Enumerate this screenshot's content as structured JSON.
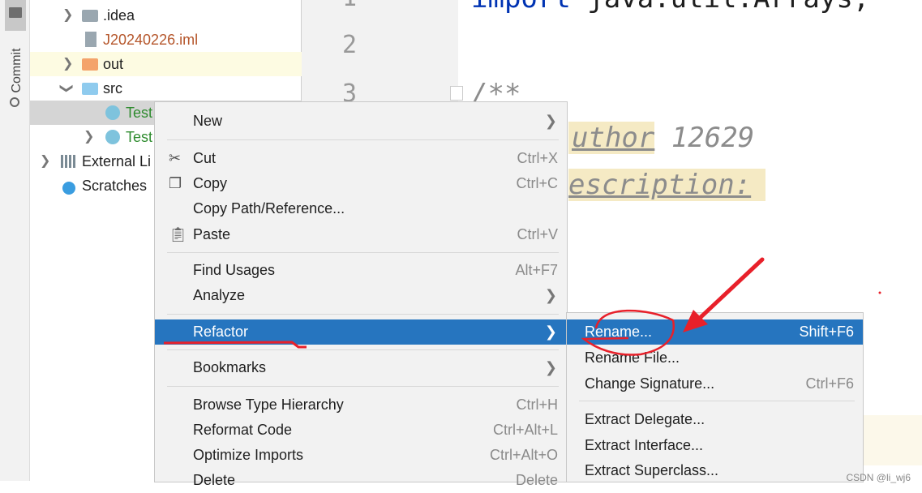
{
  "tool_strip": {
    "commit_label": "Commit"
  },
  "project_tree": [
    {
      "label": ".idea",
      "type": "folder",
      "color": "#1f1f1f"
    },
    {
      "label": "J20240226.iml",
      "type": "file",
      "color": "#b5562b"
    },
    {
      "label": "out",
      "type": "folder-orange",
      "color": "#1f1f1f"
    },
    {
      "label": "src",
      "type": "folder-blue",
      "color": "#1f1f1f"
    },
    {
      "label": "Test",
      "type": "class-run",
      "color": "#2e8b2e"
    },
    {
      "label": "Test",
      "type": "class",
      "color": "#2e8b2e"
    },
    {
      "label": "External Li",
      "type": "library",
      "color": "#1f1f1f"
    },
    {
      "label": "Scratches",
      "type": "scratches",
      "color": "#1f1f1f"
    }
  ],
  "editor": {
    "line_numbers": [
      "1",
      "2",
      "3"
    ],
    "line1_keyword": "import",
    "line1_rest": " java.util.Arrays;",
    "line3": "/**",
    "line4_tag": "uthor",
    "line4_rest": " 12629",
    "line5_tag": "escription:"
  },
  "context_menu": {
    "items": [
      {
        "label": "New",
        "arrow": true
      },
      {
        "label": "Cut",
        "shortcut": "Ctrl+X",
        "icon": "scissors-icon"
      },
      {
        "label": "Copy",
        "shortcut": "Ctrl+C",
        "icon": "copy-icon"
      },
      {
        "label": "Copy Path/Reference..."
      },
      {
        "label": "Paste",
        "shortcut": "Ctrl+V",
        "icon": "clipboard-icon"
      },
      {
        "label": "Find Usages",
        "shortcut": "Alt+F7"
      },
      {
        "label": "Analyze",
        "arrow": true
      },
      {
        "label": "Refactor",
        "arrow": true,
        "selected": true
      },
      {
        "label": "Bookmarks",
        "arrow": true
      },
      {
        "label": "Browse Type Hierarchy",
        "shortcut": "Ctrl+H"
      },
      {
        "label": "Reformat Code",
        "shortcut": "Ctrl+Alt+L"
      },
      {
        "label": "Optimize Imports",
        "shortcut": "Ctrl+Alt+O"
      },
      {
        "label": "Delete",
        "shortcut": "Delete"
      }
    ]
  },
  "refactor_submenu": {
    "items": [
      {
        "label": "Rename...",
        "shortcut": "Shift+F6",
        "selected": true
      },
      {
        "label": "Rename File..."
      },
      {
        "label": "Change Signature...",
        "shortcut": "Ctrl+F6"
      },
      {
        "label": "Extract Delegate..."
      },
      {
        "label": "Extract Interface..."
      },
      {
        "label": "Extract Superclass..."
      }
    ]
  },
  "colors": {
    "selection": "#2675bf",
    "annotation": "#e8202a",
    "doc_highlight": "#f5eac4"
  },
  "watermark": "CSDN @li_wj6"
}
